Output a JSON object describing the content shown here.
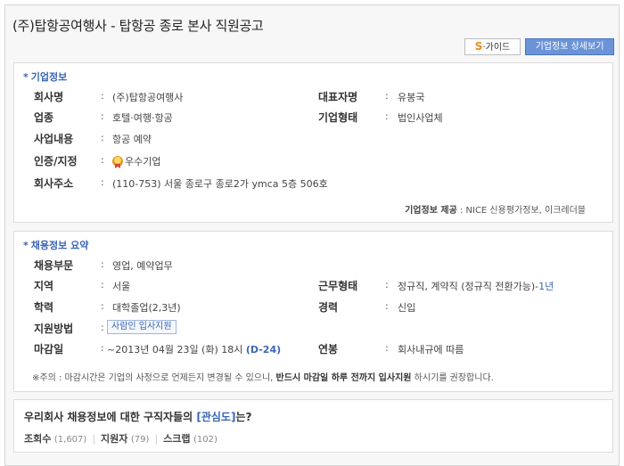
{
  "page": {
    "title": "(주)탑항공여행사 - 탑항공 종로 본사 직원공고"
  },
  "buttons": {
    "s_guide_mark": "S",
    "s_guide_label": "·가이드",
    "detail_label": "기업정보 상세보기"
  },
  "company": {
    "section_title": "기업정보",
    "name_label": "회사명",
    "name_value": "(주)탑항공여행사",
    "ceo_label": "대표자명",
    "ceo_value": "유봉국",
    "industry_label": "업종",
    "industry_value": "호텔·여행·항공",
    "type_label": "기업형태",
    "type_value": "법인사업체",
    "business_label": "사업내용",
    "business_value": "항공 예약",
    "cert_label": "인증/지정",
    "cert_value": "우수기업",
    "address_label": "회사주소",
    "address_value": "(110-753) 서울 종로구 종로2가 ymca 5층 506호",
    "provider_label": "기업정보 제공",
    "provider_value": " : NICE 신용평가정보, 이크레더블"
  },
  "recruit": {
    "section_title": "채용정보 요약",
    "dept_label": "채용부문",
    "dept_value": "영업, 예약업무",
    "region_label": "지역",
    "region_value": "서울",
    "worktype_label": "근무형태",
    "worktype_value": "정규직, 계약직 (정규직 전환가능)-",
    "worktype_period": "1년",
    "edu_label": "학력",
    "edu_value": "대학졸업(2,3년)",
    "career_label": "경력",
    "career_value": "신입",
    "apply_label": "지원방법",
    "apply_value": "사람인 입사지원",
    "deadline_label": "마감일",
    "deadline_value": "~2013년 04월 23일 (화) 18시 ",
    "deadline_dday": "(D-24)",
    "salary_label": "연봉",
    "salary_value": "회사내규에 따름",
    "notice_prefix": "※주의 : 마감시간은 기업의 사정으로 언제든지 변경될 수 있으니, ",
    "notice_bold": "반드시 마감일 하루 전까지 입사지원",
    "notice_suffix": " 하시기를 권장합니다."
  },
  "interest": {
    "question_prefix": "우리회사 채용정보에 대한 구직자들의 ",
    "question_bracket": "[관심도]",
    "question_suffix": "는?",
    "views_label": "조회수",
    "views_value": "(1,607)",
    "applicants_label": "지원자",
    "applicants_value": "(79)",
    "scraps_label": "스크랩",
    "scraps_value": "(102)"
  }
}
